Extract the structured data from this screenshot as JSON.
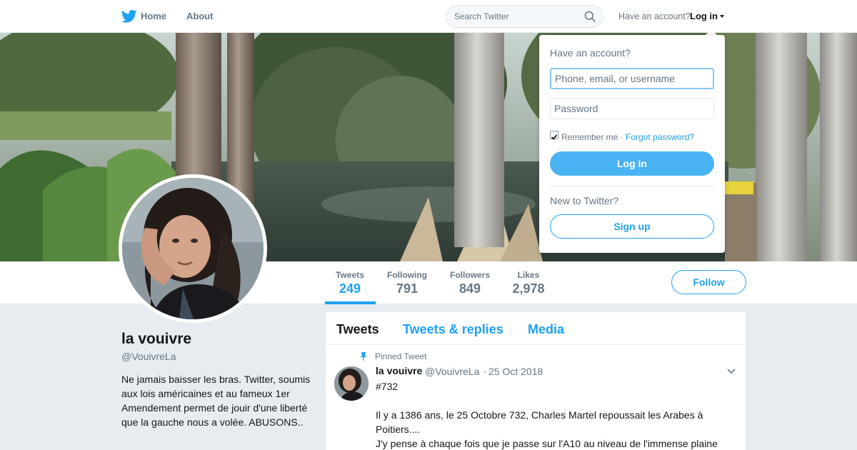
{
  "nav": {
    "home_label": "Home",
    "about_label": "About",
    "search_placeholder": "Search Twitter",
    "have_account_label": "Have an account?",
    "login_label": "Log in"
  },
  "profile": {
    "name": "la vouivre",
    "handle": "@VouivreLa",
    "bio": "Ne jamais baisser les bras. Twitter, soumis aux lois américaines et au fameux 1er Amendement permet de jouir d'une liberté que la gauche nous a volée. ABUSONS.."
  },
  "stats": [
    {
      "label": "Tweets",
      "value": "249",
      "active": true
    },
    {
      "label": "Following",
      "value": "791",
      "active": false
    },
    {
      "label": "Followers",
      "value": "849",
      "active": false
    },
    {
      "label": "Likes",
      "value": "2,978",
      "active": false
    }
  ],
  "follow_label": "Follow",
  "timeline": {
    "tabs": [
      "Tweets",
      "Tweets & replies",
      "Media"
    ],
    "pinned_label": "Pinned Tweet",
    "tweet": {
      "name": "la vouivre",
      "handle": "@VouivreLa",
      "separator": "·",
      "date": "25 Oct 2018",
      "lines": [
        "#732",
        "Il y a 1386 ans, le 25 Octobre 732, Charles Martel repoussait les Arabes à Poitiers....",
        "J'y pense à chaque fois que je passe sur l'A10 au niveau de l'immense plaine"
      ]
    }
  },
  "login_dropdown": {
    "title": "Have an account?",
    "username_placeholder": "Phone, email, or username",
    "password_placeholder": "Password",
    "remember_label": "Remember me ·",
    "remember_checked": true,
    "forgot_label": "Forgot password?",
    "login_button": "Log in",
    "new_label": "New to Twitter?",
    "signup_button": "Sign up"
  },
  "colors": {
    "accent": "#1da1f2",
    "login_button": "#4ab3f4",
    "page_bg": "#e6ecf0"
  }
}
